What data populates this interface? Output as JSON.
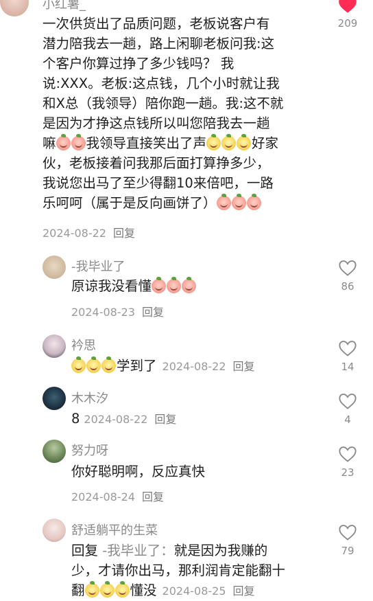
{
  "colors": {
    "like_red": "#ff2d55",
    "meta_gray": "#9a9a9a",
    "icon_gray": "#8a8a8a"
  },
  "icons": {
    "heart_filled": "heart-filled-icon",
    "heart_outline": "heart-outline-icon",
    "cry_emoji": "crying-peach-emoji-icon",
    "laugh_emoji": "laughing-peach-emoji-icon"
  },
  "main_comment": {
    "author": "小红薯_",
    "lines": [
      "一次供货出了品质问题，老板说客户有",
      "潜力陪我去一趟，路上闲聊老板问我:这",
      "个客户你算过挣了多少钱吗？ 我",
      "说:XXX。老板:这点钱，几个小时就让我",
      "和X总（我领导）陪你跑一趟。我:这不就",
      "是因为才挣这点钱所以叫您陪我去一趟"
    ],
    "line7_a": "嘛",
    "line7_b": "我领导直接笑出了声",
    "line7_c": "好家",
    "line8": "伙，老板接着问我那后面打算挣多少，",
    "line9": "我说您出马了至少得翻10来倍吧，一路",
    "line10": "乐呵呵（属于是反向画饼了）",
    "date": "2024-08-22",
    "reply_label": "回复",
    "like_count": "209"
  },
  "replies": [
    {
      "author": "-我毕业了",
      "text": "原谅我没看懂",
      "date": "2024-08-23",
      "reply_label": "回复",
      "like_count": "86"
    },
    {
      "author": "衿思",
      "text": "学到了",
      "date": "2024-08-22",
      "reply_label": "回复",
      "like_count": "14"
    },
    {
      "author": "木木汐",
      "text": "8",
      "date": "2024-08-22",
      "reply_label": "回复",
      "like_count": "4"
    },
    {
      "author": "努力呀",
      "text": "你好聪明啊，反应真快",
      "date": "2024-08-24",
      "reply_label": "回复",
      "like_count": "23"
    },
    {
      "author": "舒适躺平的生菜",
      "text_prefix": "回复",
      "mention": "-我毕业了：",
      "text_line1": "就是因为我赚的",
      "text_line2": "少，才请你出马，那利润肯定能翻十",
      "text_line3_a": "翻",
      "text_line3_b": "懂没",
      "date": "2024-08-25",
      "reply_label": "回复",
      "like_count": "79"
    }
  ]
}
